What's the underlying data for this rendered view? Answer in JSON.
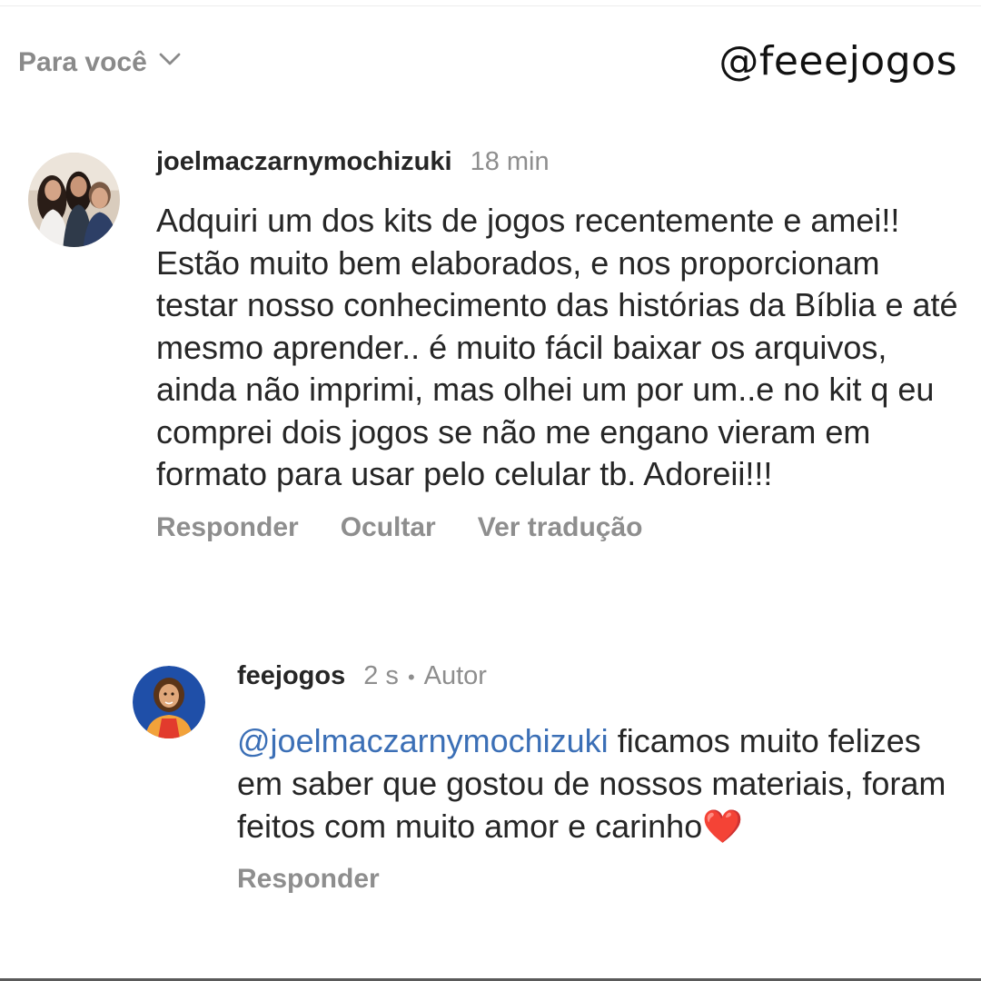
{
  "header": {
    "filter_label": "Para você",
    "watermark": "@feeejogos"
  },
  "comments": [
    {
      "username": "joelmaczarnymochizuki",
      "time": "18 min",
      "text": "Adquiri um dos kits de jogos recentemente e amei!! Estão muito bem elaborados, e nos proporcionam testar nosso conhecimento das histórias da Bíblia e até mesmo aprender.. é muito fácil baixar os arquivos, ainda não imprimi, mas olhei um por um..e no kit q eu comprei dois jogos se não me engano vieram em formato para usar pelo celular tb. Adoreii!!!",
      "actions": {
        "reply": "Responder",
        "hide": "Ocultar",
        "translate": "Ver tradução"
      }
    },
    {
      "username": "feejogos",
      "time": "2 s",
      "separator": "•",
      "author_badge": "Autor",
      "mention": "@joelmaczarnymochizuki",
      "text": " ficamos muito felizes em saber que gostou de nossos materiais, foram feitos com muito amor e carinho",
      "emoji": "❤️",
      "actions": {
        "reply": "Responder"
      }
    }
  ],
  "colors": {
    "mention": "#3b6fb6",
    "secondary_text": "#8e8e8e",
    "primary_text": "#262626",
    "heart": "#e8283a"
  },
  "icons": {
    "filter": "chevron-down-icon"
  }
}
